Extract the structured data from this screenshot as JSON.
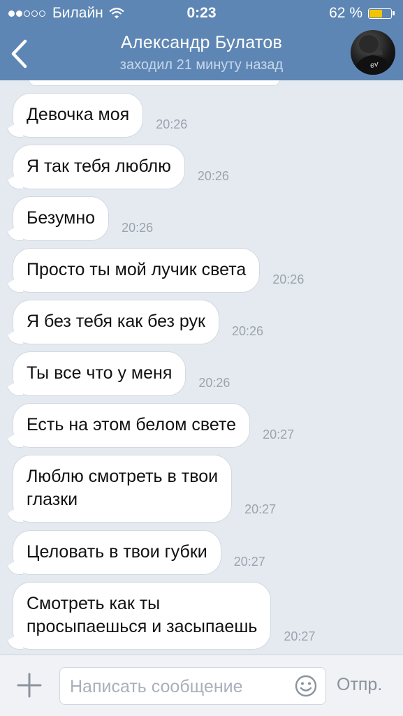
{
  "status_bar": {
    "carrier": "Билайн",
    "time": "0:23",
    "battery_percent": "62 %",
    "battery_level": 0.62,
    "signal_bars_filled": 2,
    "signal_bars_total": 5
  },
  "header": {
    "contact_name": "Александр Булатов",
    "contact_status": "заходил 21 минуту назад",
    "avatar_text": "ev"
  },
  "messages": [
    {
      "text": "Девочка моя",
      "time": "20:26"
    },
    {
      "text": "Я так тебя люблю",
      "time": "20:26"
    },
    {
      "text": "Безумно",
      "time": "20:26"
    },
    {
      "text": "Просто ты мой лучик света",
      "time": "20:26"
    },
    {
      "text": "Я без тебя как без рук",
      "time": "20:26"
    },
    {
      "text": "Ты все что у меня",
      "time": "20:26"
    },
    {
      "text": "Есть на этом белом свете",
      "time": "20:27"
    },
    {
      "text": "Люблю смотреть в твои\nглазки",
      "time": "20:27"
    },
    {
      "text": "Целовать в твои губки",
      "time": "20:27"
    },
    {
      "text": "Смотреть как ты\nпросыпаешься и засыпаешь",
      "time": "20:27"
    }
  ],
  "composer": {
    "placeholder": "Написать сообщение",
    "send_label": "Отпр."
  },
  "icons": {
    "back": "chevron-left-icon",
    "wifi": "wifi-icon",
    "attach": "plus-icon",
    "emoji": "smiley-icon"
  },
  "colors": {
    "header_bg": "#5e86b4",
    "chat_bg": "#e5eaf0",
    "battery_fill": "#f5c400"
  }
}
